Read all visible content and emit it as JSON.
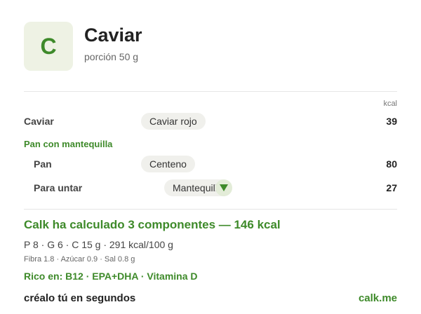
{
  "header": {
    "avatar_letter": "C",
    "title": "Caviar",
    "subtitle": "porción 50 g"
  },
  "table": {
    "unit_header": "kcal",
    "rows": [
      {
        "label": "Caviar",
        "choice": "Caviar rojo",
        "kcal": "39"
      }
    ],
    "group": {
      "label": "Pan con mantequilla",
      "rows": [
        {
          "label": "Pan",
          "choice": "Centeno",
          "kcal": "80"
        },
        {
          "label": "Para untar",
          "choice": "Mantequilla",
          "kcal": "27"
        }
      ]
    }
  },
  "summary": {
    "calculated": "Calk ha calculado 3 componentes — 146 kcal",
    "macros": "P 8 · G 6 · C 15 g   ·   291 kcal/100 g",
    "micros": "Fibra 1.8 · Azúcar 0.9 · Sal 0.8 g",
    "rich_in": "Rico en: B12 · EPA+DHA · Vitamina D"
  },
  "footer": {
    "cta": "créalo tú en segundos",
    "brand": "calk.me"
  },
  "colors": {
    "accent": "#3e8a2a",
    "avatar_bg": "#eef2e4",
    "pill_bg": "#f0f0ec"
  },
  "icons": {
    "expand": "chevron-down-icon"
  }
}
